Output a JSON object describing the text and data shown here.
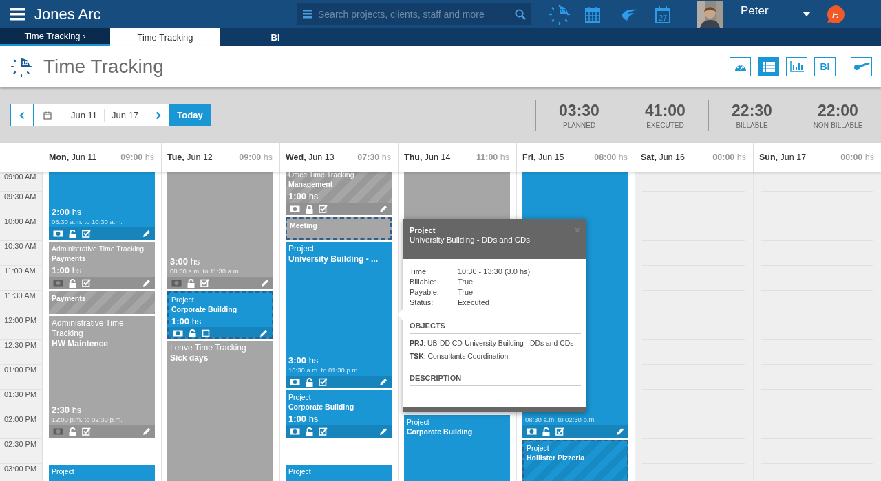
{
  "app": {
    "title": "Jones Arc",
    "search_placeholder": "Search projects, clients, staff and more",
    "timer_badge": "15",
    "calendar_day": "27",
    "user": "Peter",
    "logo_text": "F."
  },
  "nav_tabs": [
    {
      "label": "Time Tracking ›",
      "selected": false,
      "kind": "crumb"
    },
    {
      "label": "Time Tracking",
      "selected": true,
      "kind": "tab"
    },
    {
      "label": "BI",
      "selected": false,
      "kind": "tab"
    }
  ],
  "page": {
    "title": "Time Tracking",
    "icon_badge": "15"
  },
  "view_buttons": [
    {
      "kind": "gauge",
      "selected": false
    },
    {
      "kind": "list",
      "selected": true
    },
    {
      "kind": "chart",
      "selected": false
    },
    {
      "kind": "text",
      "label": "BI",
      "selected": false
    },
    {
      "kind": "key",
      "selected": false
    }
  ],
  "date_range": {
    "from": "Jun 11",
    "to": "Jun 17",
    "today": "Today"
  },
  "stats": [
    {
      "value": "03:30",
      "label": "PLANNED"
    },
    {
      "value": "41:00",
      "label": "EXECUTED"
    },
    {
      "value": "22:30",
      "label": "BILLABLE"
    },
    {
      "value": "22:00",
      "label": "NON-BILLABLE"
    }
  ],
  "time_labels": [
    "09:00 AM",
    "09:30 AM",
    "10:00 AM",
    "10:30 AM",
    "11:00 AM",
    "11:30 AM",
    "12:00 PM",
    "12:30 PM",
    "01:00 PM",
    "01:30 PM",
    "02:00 PM",
    "02:30 PM",
    "03:00 PM"
  ],
  "days": [
    {
      "day": "Mon,",
      "date": "Jun 11",
      "hours": "09:00",
      "unit": "hs",
      "weekend": false,
      "events": [
        {
          "color": "#1a96d4",
          "hours": "2:00",
          "unit": "hs",
          "range": "08:30 a.m. to 10:30 a.m.",
          "billable": true,
          "locked": false,
          "approved": true
        },
        {
          "color": "#a6a6a6",
          "category": "Administrative Time Tracking",
          "title": "Payments",
          "hours": "1:00",
          "unit": "hs",
          "billable": false,
          "locked": false,
          "approved": true
        },
        {
          "color": "#a6a6a6",
          "striped": true,
          "title": "Payments"
        },
        {
          "color": "#a6a6a6",
          "category": "Administrative Time Tracking",
          "title": "HW Maintence",
          "hours": "2:30",
          "unit": "hs",
          "range": "12:00 p.m. to 02:30 p.m.",
          "billable": false,
          "locked": false,
          "approved": true
        },
        {
          "color": "#1a96d4",
          "category": "Project"
        }
      ]
    },
    {
      "day": "Tue,",
      "date": "Jun 12",
      "hours": "09:00",
      "unit": "hs",
      "weekend": false,
      "events": [
        {
          "color": "#a6a6a6",
          "hours": "3:00",
          "unit": "hs",
          "range": "08:30 a.m. to 11:30 a.m.",
          "billable": false,
          "locked": false,
          "approved": true
        },
        {
          "color": "#1a96d4",
          "outlined": true,
          "category": "Project",
          "title": "Corporate Building",
          "hours": "1:00",
          "unit": "hs",
          "billable": true,
          "locked": false,
          "approved": false
        },
        {
          "color": "#a6a6a6",
          "category": "Leave Time Tracking",
          "title": "Sick days"
        }
      ]
    },
    {
      "day": "Wed,",
      "date": "Jun 13",
      "hours": "07:30",
      "unit": "hs",
      "weekend": false,
      "events": [
        {
          "color": "#a6a6a6",
          "striped": true,
          "category": "Office Time Tracking",
          "title": "Management",
          "hours": "1:00",
          "unit": "hs",
          "billable": true,
          "locked": true,
          "approved": true
        },
        {
          "color": "#a6a6a6",
          "outlined": true,
          "title": "Meeting"
        },
        {
          "color": "#1a96d4",
          "category": "Project",
          "title": "University Building - ...",
          "hours": "3:00",
          "unit": "hs",
          "range": "10:30 a.m. to 01:30 p.m.",
          "billable": true,
          "locked": false,
          "approved": true
        },
        {
          "color": "#1a96d4",
          "category": "Project",
          "title": "Corporate Building",
          "hours": "1:00",
          "unit": "hs",
          "billable": true,
          "locked": false,
          "approved": true
        },
        {
          "color": "#1a96d4",
          "category": "Project"
        }
      ]
    },
    {
      "day": "Thu,",
      "date": "Jun 14",
      "hours": "11:00",
      "unit": "hs",
      "weekend": false,
      "events": [
        {
          "color": "#a6a6a6"
        },
        {
          "color": "#1a96d4",
          "category": "Project",
          "title": "Corporate Building"
        }
      ]
    },
    {
      "day": "Fri,",
      "date": "Jun 15",
      "hours": "08:00",
      "unit": "hs",
      "weekend": false,
      "events": [
        {
          "color": "#1a96d4",
          "range": "08:30 a.m. to 02:30 p.m.",
          "billable": true,
          "locked": false,
          "approved": true
        },
        {
          "color": "#1a96d4",
          "striped": true,
          "outlined": true,
          "category": "Project",
          "title": "Hollister Pizzeria"
        }
      ]
    },
    {
      "day": "Sat,",
      "date": "Jun 16",
      "hours": "00:00",
      "unit": "hs",
      "weekend": true
    },
    {
      "day": "Sun,",
      "date": "Jun 17",
      "hours": "00:00",
      "unit": "hs",
      "weekend": true
    }
  ],
  "popup": {
    "kind_label": "Project",
    "title": "University Building - DDs and CDs",
    "close": "×",
    "fields": [
      {
        "label": "Time:",
        "value": "10:30 - 13:30 (3.0 hs)"
      },
      {
        "label": "Billable:",
        "value": "True"
      },
      {
        "label": "Payable:",
        "value": "True"
      },
      {
        "label": "Status:",
        "value": "Executed"
      }
    ],
    "objects_heading": "OBJECTS",
    "objects": [
      "**PRJ**: UB-DD CD-University Building - DDs and CDs",
      "**TSK**: Consultants Coordination"
    ],
    "description_heading": "DESCRIPTION"
  }
}
